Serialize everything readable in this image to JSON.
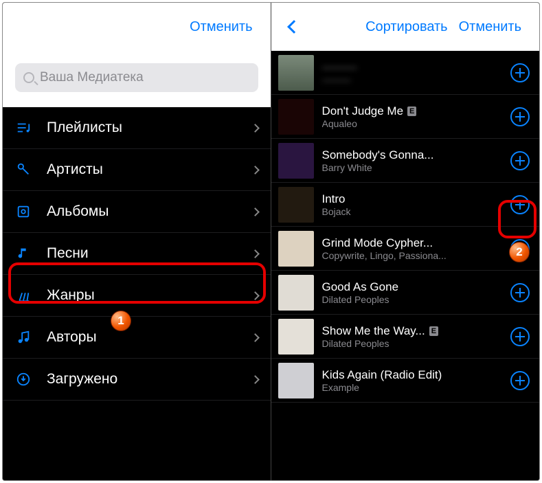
{
  "left": {
    "header": {
      "cancel": "Отменить"
    },
    "search_placeholder": "Ваша Медиатека",
    "cats": [
      {
        "key": "playlists",
        "label": "Плейлисты"
      },
      {
        "key": "artists",
        "label": "Артисты"
      },
      {
        "key": "albums",
        "label": "Альбомы"
      },
      {
        "key": "songs",
        "label": "Песни"
      },
      {
        "key": "genres",
        "label": "Жанры"
      },
      {
        "key": "composers",
        "label": "Авторы"
      },
      {
        "key": "downloaded",
        "label": "Загружено"
      }
    ]
  },
  "right": {
    "header": {
      "sort": "Сортировать",
      "cancel": "Отменить"
    },
    "songs": [
      {
        "title": "———",
        "artist": "———",
        "explicit": false,
        "art": "a0",
        "blurred": true
      },
      {
        "title": "Don't Judge Me",
        "artist": "Aqualeo",
        "explicit": true,
        "art": "a1"
      },
      {
        "title": "Somebody's Gonna...",
        "artist": "Barry White",
        "explicit": false,
        "art": "a2"
      },
      {
        "title": "Intro",
        "artist": "Bojack",
        "explicit": false,
        "art": "a3"
      },
      {
        "title": "Grind Mode Cypher...",
        "artist": "Copywrite, Lingo, Passiona...",
        "explicit": false,
        "art": "a4"
      },
      {
        "title": "Good As Gone",
        "artist": "Dilated Peoples",
        "explicit": false,
        "art": "a5"
      },
      {
        "title": "Show Me the Way...",
        "artist": "Dilated Peoples",
        "explicit": true,
        "art": "a6"
      },
      {
        "title": "Kids Again (Radio Edit)",
        "artist": "Example",
        "explicit": false,
        "art": "a7"
      }
    ]
  },
  "annotations": {
    "badge1": "1",
    "badge2": "2"
  },
  "icons": {
    "playlists": "playlist-icon",
    "artists": "mic-icon",
    "albums": "album-icon",
    "songs": "note-icon",
    "genres": "guitar-icon",
    "composers": "notes-icon",
    "downloaded": "download-icon"
  },
  "colors": {
    "accent": "#007aff",
    "accent_dark": "#0a84ff"
  }
}
